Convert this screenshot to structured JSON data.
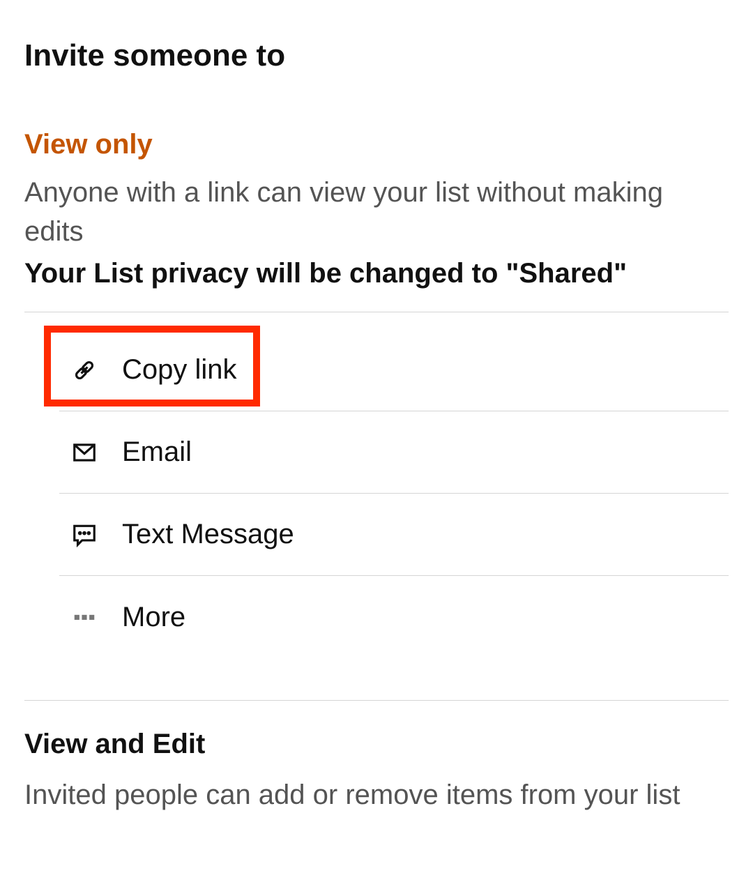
{
  "title": "Invite someone to",
  "view_only": {
    "label": "View only",
    "desc": "Anyone with a link can view your list without making edits",
    "note": "Your List privacy will be changed to \"Shared\""
  },
  "options": {
    "copy_link": "Copy link",
    "email": "Email",
    "text_message": "Text Message",
    "more": "More"
  },
  "view_edit": {
    "label": "View and Edit",
    "desc": "Invited people can add or remove items from your list"
  }
}
